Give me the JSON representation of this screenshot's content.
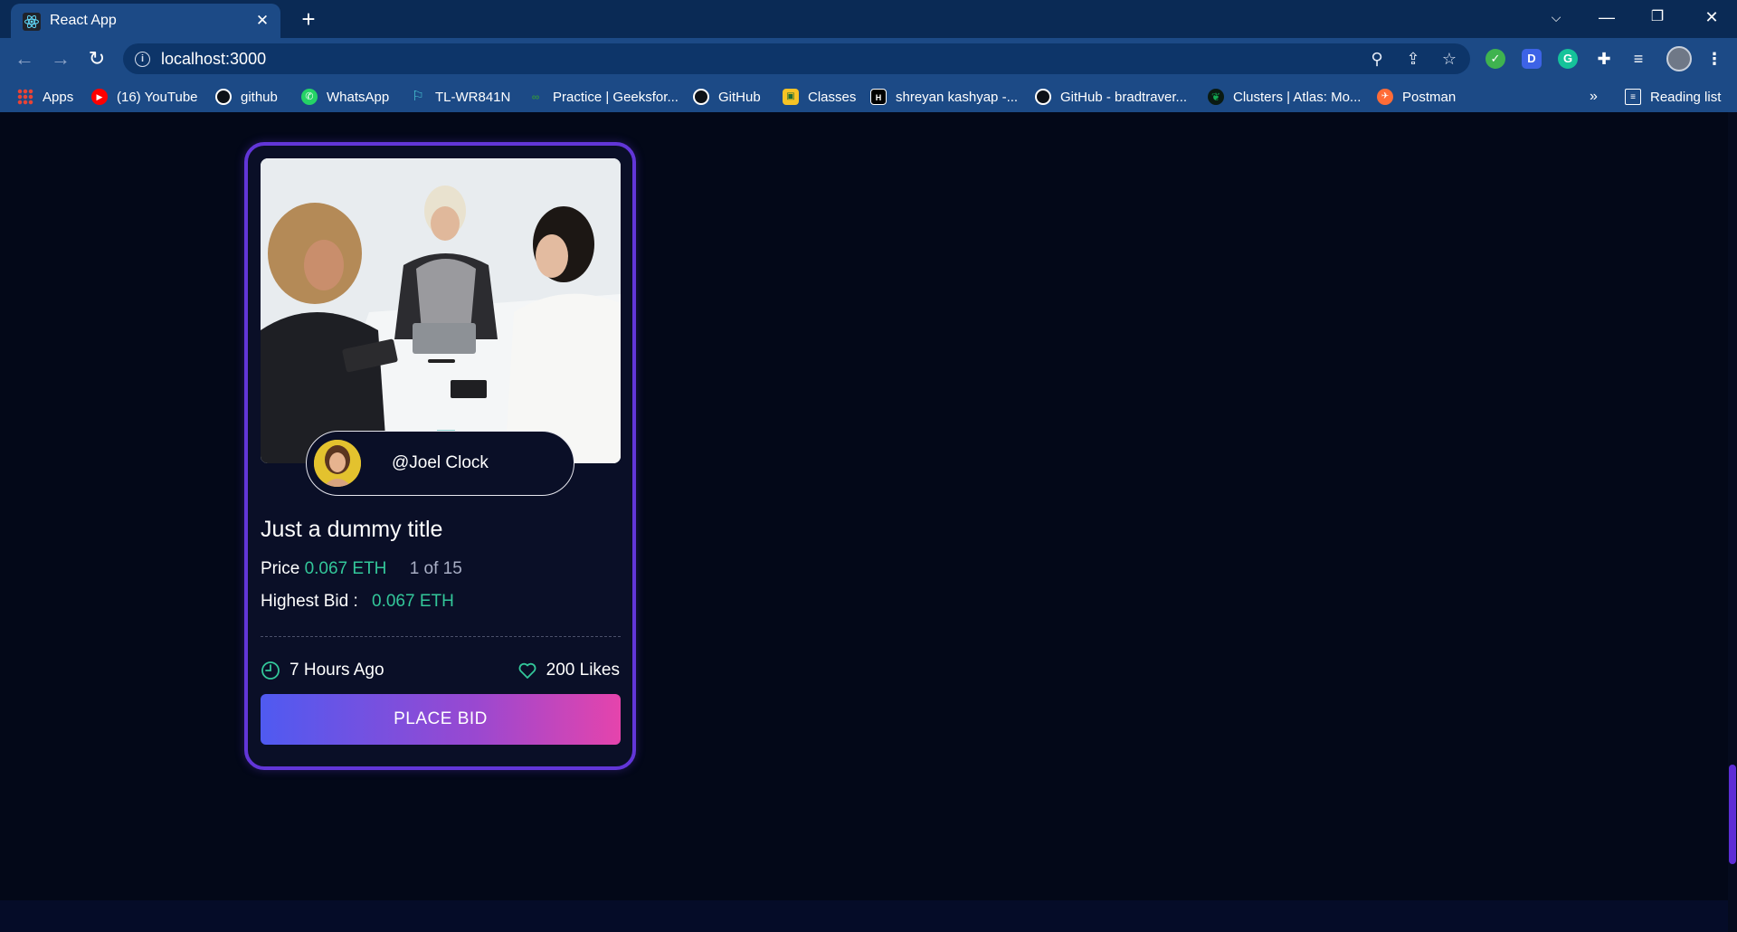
{
  "browser": {
    "tab_title": "React App",
    "url": "localhost:3000",
    "bookmarks": [
      {
        "label": "Apps",
        "icon": "apps-grid-icon"
      },
      {
        "label": "(16) YouTube",
        "icon": "youtube-icon"
      },
      {
        "label": "github",
        "icon": "github-icon"
      },
      {
        "label": "WhatsApp",
        "icon": "whatsapp-icon"
      },
      {
        "label": "TL-WR841N",
        "icon": "tplink-icon"
      },
      {
        "label": "Practice | Geeksfor...",
        "icon": "geeksforgeeks-icon"
      },
      {
        "label": "GitHub",
        "icon": "github-icon"
      },
      {
        "label": "Classes",
        "icon": "classroom-icon"
      },
      {
        "label": "shreyan kashyap -...",
        "icon": "hackerrank-icon"
      },
      {
        "label": "GitHub - bradtraver...",
        "icon": "github-icon"
      },
      {
        "label": "Clusters | Atlas: Mo...",
        "icon": "mongodb-leaf-icon"
      },
      {
        "label": "Postman",
        "icon": "postman-icon"
      }
    ],
    "more_bookmarks": "»",
    "reading_list": "Reading list"
  },
  "card": {
    "creator": "@Joel Clock",
    "title": "Just a dummy title",
    "price_label": "Price",
    "price_value": "0.067 ETH",
    "edition": "1 of 15",
    "highest_bid_label": "Highest Bid :",
    "highest_bid_value": "0.067 ETH",
    "time": "7 Hours Ago",
    "likes": "200 Likes",
    "button_label": "PLACE BID"
  },
  "colors": {
    "accent_green": "#33c79a",
    "card_border": "#6236d8",
    "button_gradient_start": "#4f5af1",
    "button_gradient_end": "#e544ac",
    "page_background": "#030818"
  }
}
